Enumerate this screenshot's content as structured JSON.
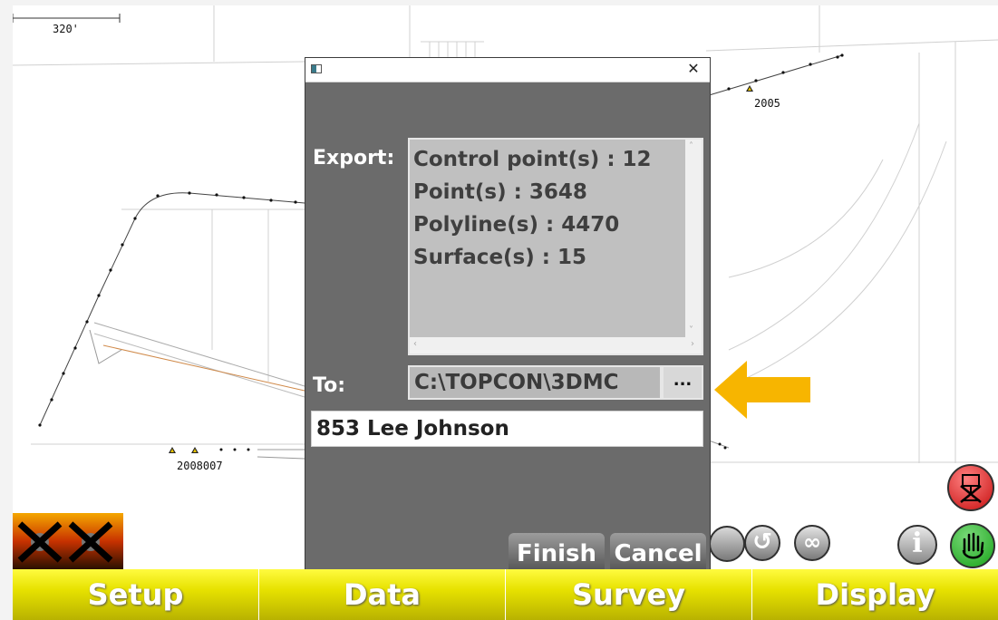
{
  "map": {
    "scale_label": "320'",
    "point_labels": [
      "2005",
      "2008007"
    ]
  },
  "dialog": {
    "export_label": "Export:",
    "summary": [
      "Control point(s) : 12",
      "Point(s) : 3648",
      "Polyline(s) : 4470",
      "Surface(s) : 15"
    ],
    "to_label": "To:",
    "path": "C:\\TOPCON\\3DMC",
    "browse_label": "...",
    "job_name": "853 Lee Johnson",
    "finish_label": "Finish",
    "cancel_label": "Cancel",
    "close_glyph": "✕"
  },
  "toolbar_icons": {
    "rotate_glyph": "↺",
    "infinity_glyph": "∞",
    "info_glyph": "i"
  },
  "menu": [
    {
      "label": "Setup"
    },
    {
      "label": "Data"
    },
    {
      "label": "Survey"
    },
    {
      "label": "Display"
    }
  ],
  "colors": {
    "menu_yellow": "#e7e200",
    "arrow": "#f7b500",
    "dialog_bg": "#6b6b6b",
    "finish_green": "#18a318",
    "stop_red": "#c61010"
  }
}
